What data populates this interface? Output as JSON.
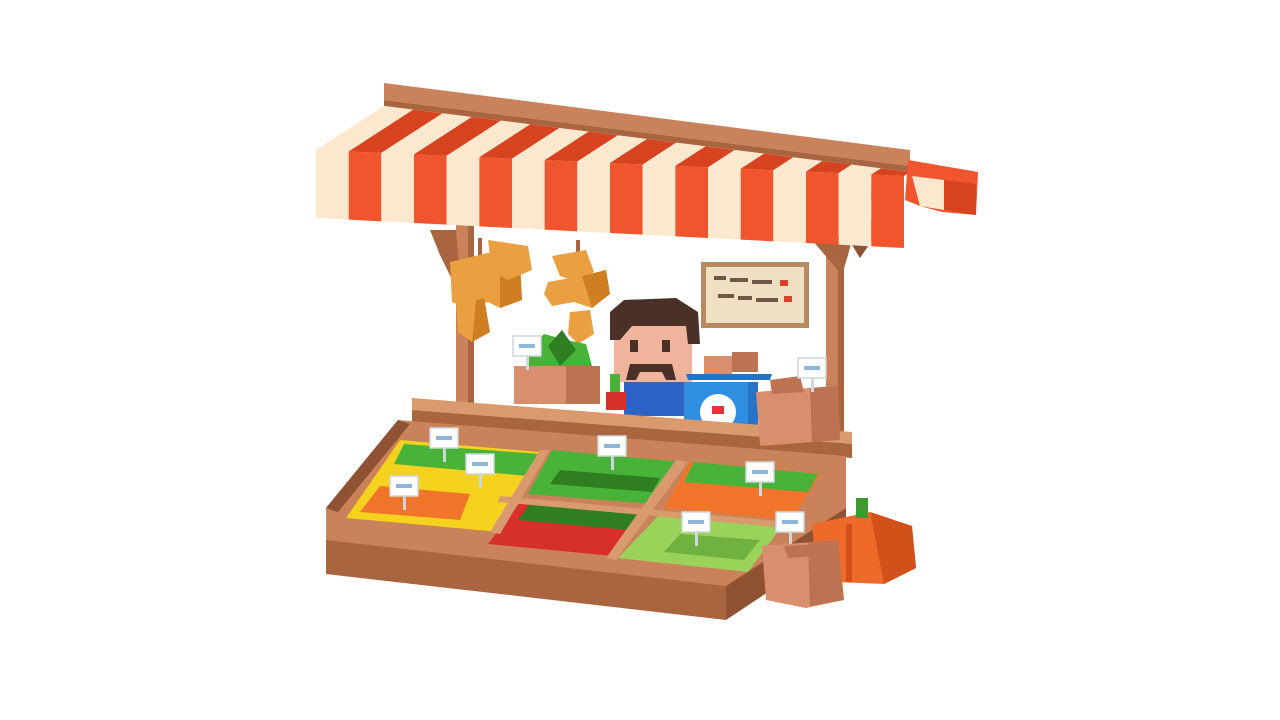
{
  "scene": {
    "subject": "voxel-market-stall",
    "background_color": "#ffffff"
  },
  "palette": {
    "awning_red": "#f0552e",
    "awning_red_dark": "#d8431f",
    "awning_cream": "#fbe8cf",
    "wood_light": "#d99a6e",
    "wood": "#c9825a",
    "wood_dark": "#a9653f",
    "wood_deep": "#8f5232",
    "crate_clay": "#d98f6d",
    "crate_clay_dark": "#bd7352",
    "sign_board": "#efe0c4",
    "sign_frame": "#b88a60",
    "sign_ink": "#6b5848",
    "sign_red": "#d8432d",
    "gourd_orange": "#eaa040",
    "gourd_dark": "#cf7e22",
    "pumpkin": "#ef6a2a",
    "pumpkin_dark": "#d2511a",
    "stem_green": "#3f9a2e",
    "leaf_green": "#48b338",
    "leaf_dark": "#2f7f22",
    "lettuce": "#9bd35a",
    "lettuce_dark": "#6fb23f",
    "corn_yellow": "#f5d21e",
    "carrot_orange": "#f0752a",
    "tomato_red": "#d72f2a",
    "skin": "#f0b39b",
    "hair": "#4a3027",
    "shirt_blue": "#2d63c6",
    "scale_blue": "#2f8ee0",
    "scale_blue_dark": "#2473c4",
    "scale_face": "#ffffff",
    "scale_red": "#e2323a",
    "tag_white": "#ffffff",
    "tag_border": "#cfd6dc",
    "tag_accent": "#8fb6d8"
  }
}
